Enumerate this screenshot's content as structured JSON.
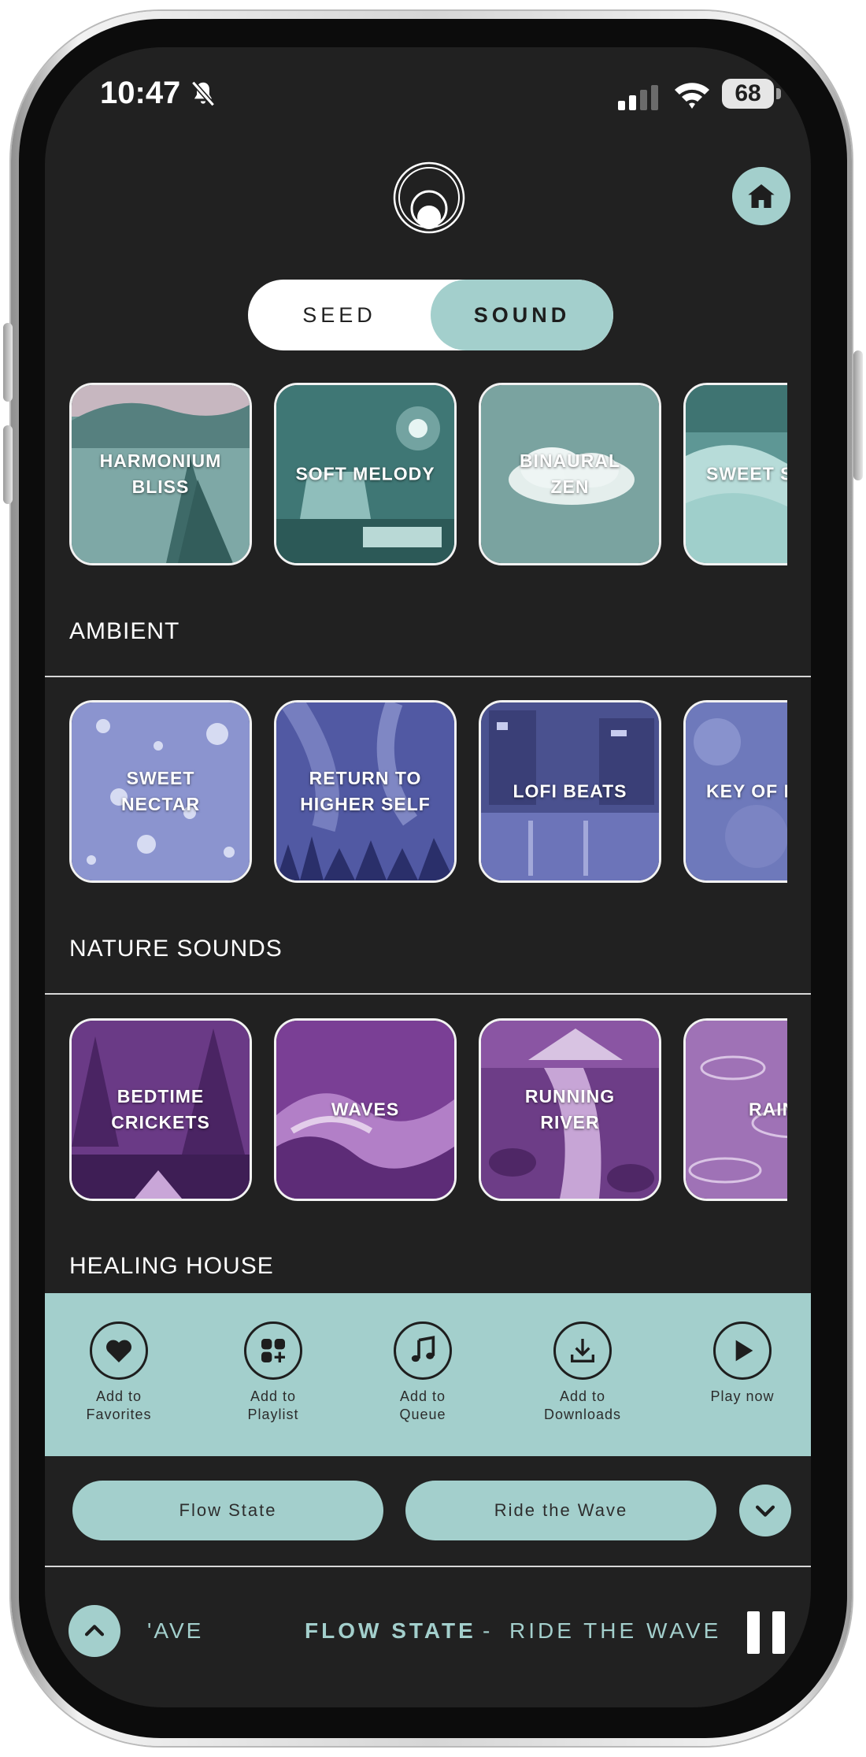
{
  "status_bar": {
    "time": "10:47",
    "battery": "68"
  },
  "toggle": {
    "seed": "SEED",
    "sound": "SOUND",
    "selected": "SOUND"
  },
  "rows": [
    {
      "tiles": [
        {
          "label": "HARMONIUM\nBLISS"
        },
        {
          "label": "SOFT MELODY"
        },
        {
          "label": "BINAURAL\nZEN"
        },
        {
          "label": "SWEET SL"
        }
      ]
    },
    {
      "tiles": [
        {
          "label": "SWEET\nNECTAR"
        },
        {
          "label": "RETURN TO\nHIGHER SELF"
        },
        {
          "label": "LOFI BEATS"
        },
        {
          "label": "KEY OF R"
        }
      ]
    },
    {
      "tiles": [
        {
          "label": "BEDTIME\nCRICKETS"
        },
        {
          "label": "WAVES"
        },
        {
          "label": "RUNNING\nRIVER"
        },
        {
          "label": "RAIN"
        }
      ]
    }
  ],
  "sections": {
    "ambient": "AMBIENT",
    "nature": "NATURE SOUNDS",
    "healing": "HEALING HOUSE"
  },
  "actions": [
    {
      "label": "Add to\nFavorites",
      "icon": "heart-icon"
    },
    {
      "label": "Add to\nPlaylist",
      "icon": "playlist-add-icon"
    },
    {
      "label": "Add to\nQueue",
      "icon": "music-note-icon"
    },
    {
      "label": "Add to\nDownloads",
      "icon": "download-icon"
    },
    {
      "label": "Play now",
      "icon": "play-icon"
    }
  ],
  "pills": {
    "first": "Flow State",
    "second": "Ride the Wave"
  },
  "now_playing": {
    "marquee": "'AVE",
    "title": "FLOW STATE",
    "separator": "-",
    "subtitle": "RIDE THE WAVE"
  },
  "colors": {
    "accent": "#a3cfcc",
    "background": "#212121"
  }
}
